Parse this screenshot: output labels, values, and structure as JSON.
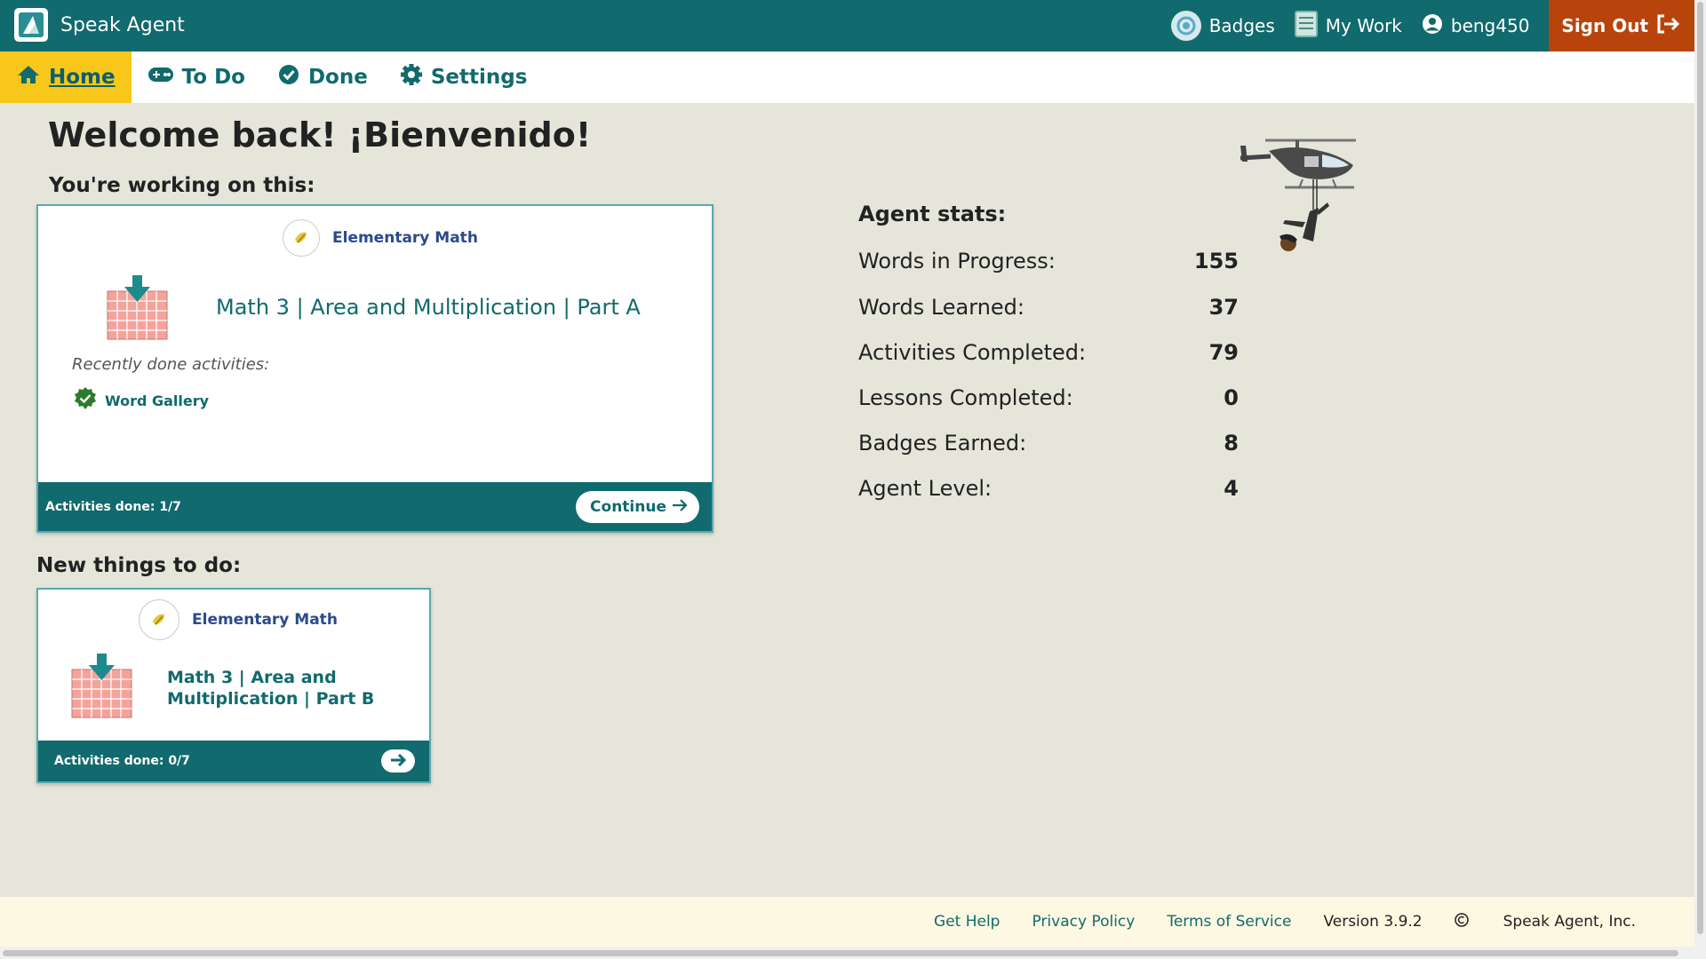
{
  "brand": {
    "name": "Speak Agent"
  },
  "topbar": {
    "badges_label": "Badges",
    "mywork_label": "My Work",
    "username": "beng450",
    "signout_label": "Sign Out"
  },
  "nav": {
    "home": "Home",
    "todo": "To Do",
    "done": "Done",
    "settings": "Settings"
  },
  "main": {
    "welcome": "Welcome back! ¡Bienvenido!",
    "working_on_label": "You're working on this:",
    "current_card": {
      "subject": "Elementary Math",
      "lesson_title": "Math 3 | Area and Multiplication | Part A",
      "recent_label": "Recently done activities:",
      "recent_activities": [
        "Word Gallery"
      ],
      "activities_done": "Activities done: 1/7",
      "continue_label": "Continue"
    },
    "new_things_label": "New things to do:",
    "new_card": {
      "subject": "Elementary Math",
      "lesson_title_line1": "Math 3 | Area and",
      "lesson_title_line2": "Multiplication | Part B",
      "activities_done": "Activities done: 0/7"
    }
  },
  "stats": {
    "title": "Agent stats:",
    "rows": [
      {
        "label": "Words in Progress:",
        "value": "155"
      },
      {
        "label": "Words Learned:",
        "value": "37"
      },
      {
        "label": "Activities Completed:",
        "value": "79"
      },
      {
        "label": "Lessons Completed:",
        "value": "0"
      },
      {
        "label": "Badges Earned:",
        "value": "8"
      },
      {
        "label": "Agent Level:",
        "value": "4"
      }
    ]
  },
  "footer": {
    "help": "Get Help",
    "privacy": "Privacy Policy",
    "terms": "Terms of Service",
    "version": "Version 3.9.2",
    "copyright": "Speak Agent, Inc."
  },
  "colors": {
    "teal": "#116a6d",
    "nav_active": "#f7c71b",
    "signout": "#b8440c",
    "background": "#e6e5da",
    "footer_bg": "#fdf8e1",
    "check_green": "#2c7a2c"
  }
}
